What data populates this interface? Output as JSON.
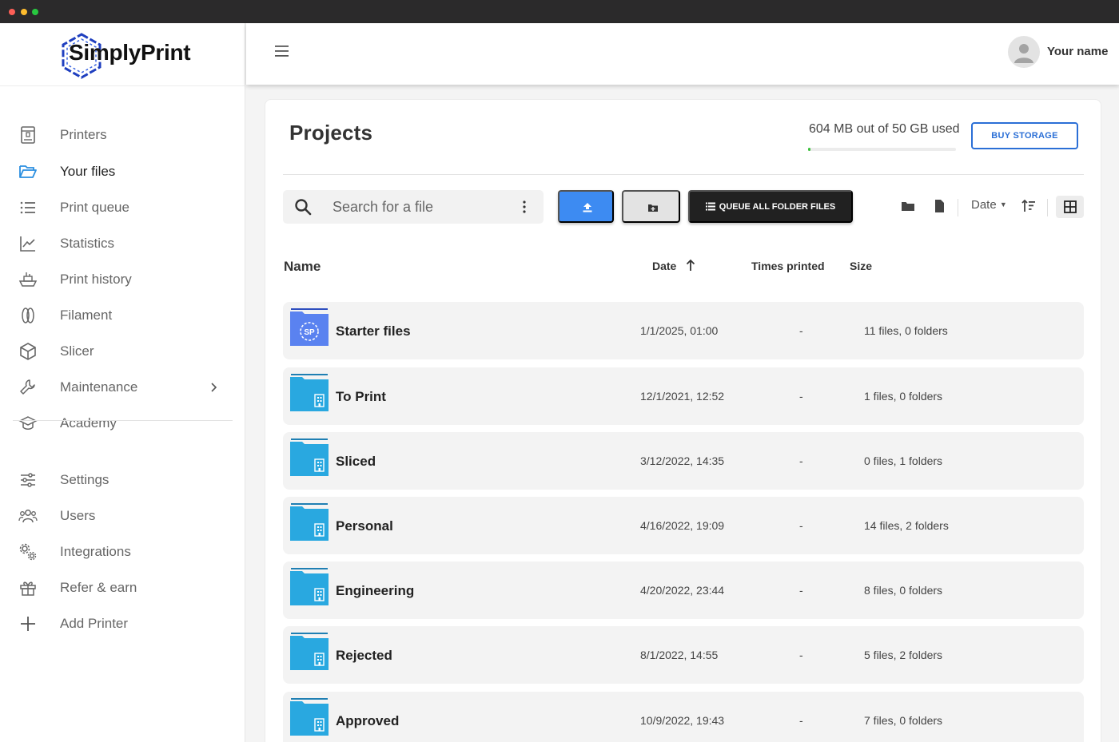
{
  "app": {
    "logo_text": "SimplyPrint",
    "logo_badge": "SP"
  },
  "sidebar": {
    "items": [
      {
        "label": "Printers",
        "icon": "printer-icon",
        "active": false
      },
      {
        "label": "Your files",
        "icon": "folder-open-icon",
        "active": true
      },
      {
        "label": "Print queue",
        "icon": "list-icon",
        "active": false
      },
      {
        "label": "Statistics",
        "icon": "line-chart-icon",
        "active": false
      },
      {
        "label": "Print history",
        "icon": "ship-icon",
        "active": false
      },
      {
        "label": "Filament",
        "icon": "filament-spool-icon",
        "active": false
      },
      {
        "label": "Slicer",
        "icon": "cube-icon",
        "active": false
      },
      {
        "label": "Maintenance",
        "icon": "wrench-icon",
        "active": false,
        "has_submenu": true
      },
      {
        "label": "Academy",
        "icon": "graduation-cap-icon",
        "active": false
      },
      {
        "label": "Settings",
        "icon": "sliders-icon",
        "active": false
      },
      {
        "label": "Users",
        "icon": "users-icon",
        "active": false
      },
      {
        "label": "Integrations",
        "icon": "gears-icon",
        "active": false
      },
      {
        "label": "Refer & earn",
        "icon": "gift-icon",
        "active": false
      },
      {
        "label": "Add Printer",
        "icon": "plus-icon",
        "active": false
      }
    ]
  },
  "header": {
    "user_name": "Your name"
  },
  "main": {
    "title": "Projects",
    "storage_text": "604 MB out of 50 GB used",
    "storage_used_fraction": 0.012,
    "buy_storage_label": "BUY STORAGE",
    "search_placeholder": "Search for a file",
    "queue_all_label": "QUEUE ALL FOLDER FILES",
    "sort_label": "Date",
    "columns": {
      "name": "Name",
      "date": "Date",
      "times_printed": "Times printed",
      "size": "Size"
    },
    "rows": [
      {
        "name": "Starter files",
        "date": "1/1/2025, 01:00",
        "times_printed": "-",
        "size": "11 files, 0 folders",
        "special": true
      },
      {
        "name": "To Print",
        "date": "12/1/2021, 12:52",
        "times_printed": "-",
        "size": "1 files, 0 folders"
      },
      {
        "name": "Sliced",
        "date": "3/12/2022, 14:35",
        "times_printed": "-",
        "size": "0 files, 1 folders"
      },
      {
        "name": "Personal",
        "date": "4/16/2022, 19:09",
        "times_printed": "-",
        "size": "14 files, 2 folders"
      },
      {
        "name": "Engineering",
        "date": "4/20/2022, 23:44",
        "times_printed": "-",
        "size": "8 files, 0 folders"
      },
      {
        "name": "Rejected",
        "date": "8/1/2022, 14:55",
        "times_printed": "-",
        "size": "5 files, 2 folders"
      },
      {
        "name": "Approved",
        "date": "10/9/2022, 19:43",
        "times_printed": "-",
        "size": "7 files, 0 folders"
      }
    ]
  },
  "colors": {
    "accent_blue": "#3d8bf2",
    "folder_blue": "#29a8e0",
    "active_nav_icon": "#2b8fe0",
    "storage_green": "#3ac13a"
  }
}
